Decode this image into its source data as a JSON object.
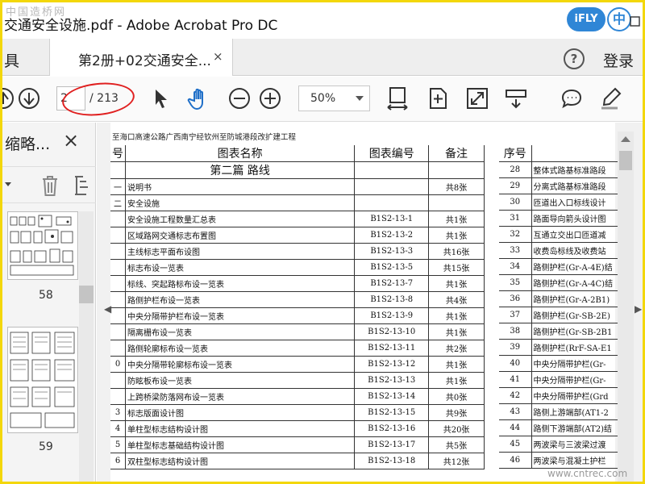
{
  "app": {
    "window_title": "交通安全设施.pdf - Adobe Acrobat Pro DC",
    "watermark": "中国造桥网",
    "ifly_label": "iFLY",
    "zh_label": "中",
    "footer_watermark": "www.cntrec.com"
  },
  "tabs": {
    "tools": "具",
    "document": "第2册+02交通安全...",
    "close": "×",
    "help": "?",
    "login": "登录"
  },
  "toolbar": {
    "page_current": "2",
    "page_total": "/ 213",
    "zoom": "50%"
  },
  "sidepanel": {
    "title": "缩略...",
    "close": "×",
    "thumb_labels": [
      "58",
      "59"
    ]
  },
  "document": {
    "title_line": "至海口高速公路广西南宁经钦州至防城港段改扩建工程",
    "left_headers": [
      "号",
      "图表名称",
      "图表编号",
      "备注"
    ],
    "right_headers": [
      "序号",
      ""
    ],
    "section_heading": "第二篇  路线",
    "left_rows": [
      {
        "no": "一",
        "name": "说明书",
        "code": "",
        "note": "共8张"
      },
      {
        "no": "二",
        "name": "安全设施",
        "code": "",
        "note": ""
      },
      {
        "no": "",
        "name": "安全设施工程数量汇总表",
        "code": "B1S2-13-1",
        "note": "共1张"
      },
      {
        "no": "",
        "name": "区域路网交通标志布置图",
        "code": "B1S2-13-2",
        "note": "共1张"
      },
      {
        "no": "",
        "name": "主线标志平面布设图",
        "code": "B1S2-13-3",
        "note": "共16张"
      },
      {
        "no": "",
        "name": "标志布设一览表",
        "code": "B1S2-13-5",
        "note": "共15张"
      },
      {
        "no": "",
        "name": "标线、突起路标布设一览表",
        "code": "B1S2-13-7",
        "note": "共1张"
      },
      {
        "no": "",
        "name": "路侧护栏布设一览表",
        "code": "B1S2-13-8",
        "note": "共4张"
      },
      {
        "no": "",
        "name": "中央分隔带护栏布设一览表",
        "code": "B1S2-13-9",
        "note": "共1张"
      },
      {
        "no": "",
        "name": "隔离栅布设一览表",
        "code": "B1S2-13-10",
        "note": "共1张"
      },
      {
        "no": "",
        "name": "路侧轮廓标布设一览表",
        "code": "B1S2-13-11",
        "note": "共2张"
      },
      {
        "no": "0",
        "name": "中央分隔带轮廓标布设一览表",
        "code": "B1S2-13-12",
        "note": "共1张"
      },
      {
        "no": "",
        "name": "防眩板布设一览表",
        "code": "B1S2-13-13",
        "note": "共1张"
      },
      {
        "no": "",
        "name": "上跨桥梁防落网布设一览表",
        "code": "B1S2-13-14",
        "note": "共0张"
      },
      {
        "no": "3",
        "name": "标志版面设计图",
        "code": "B1S2-13-15",
        "note": "共9张"
      },
      {
        "no": "4",
        "name": "单柱型标志结构设计图",
        "code": "B1S2-13-16",
        "note": "共20张"
      },
      {
        "no": "5",
        "name": "单柱型标志基础结构设计图",
        "code": "B1S2-13-17",
        "note": "共5张"
      },
      {
        "no": "6",
        "name": "双柱型标志结构设计图",
        "code": "B1S2-13-18",
        "note": "共12张"
      }
    ],
    "right_rows": [
      {
        "no": "28",
        "name": "整体式路基标准路段"
      },
      {
        "no": "29",
        "name": "分离式路基标准路段"
      },
      {
        "no": "30",
        "name": "匝道出入口标线设计"
      },
      {
        "no": "31",
        "name": "路面导向箭头设计图"
      },
      {
        "no": "32",
        "name": "互通立交出口匝道减"
      },
      {
        "no": "33",
        "name": "收费岛标线及收费站"
      },
      {
        "no": "34",
        "name": "路侧护栏(Gr-A-4E)结"
      },
      {
        "no": "35",
        "name": "路侧护栏(Gr-A-4C)结"
      },
      {
        "no": "36",
        "name": "路侧护栏(Gr-A-2B1)"
      },
      {
        "no": "37",
        "name": "路侧护栏(Gr-SB-2E)"
      },
      {
        "no": "38",
        "name": "路侧护栏(Gr-SB-2B1"
      },
      {
        "no": "39",
        "name": "路侧护栏(RrF-SA-E1"
      },
      {
        "no": "40",
        "name": "中央分隔带护栏(Gr-"
      },
      {
        "no": "41",
        "name": "中央分隔带护栏(Gr-"
      },
      {
        "no": "42",
        "name": "中央分隔带护栏(Grd"
      },
      {
        "no": "43",
        "name": "路侧上游端部(AT1-2"
      },
      {
        "no": "44",
        "name": "路侧下游端部(AT2)结"
      },
      {
        "no": "45",
        "name": "两波梁与三波梁过渡"
      },
      {
        "no": "46",
        "name": "两波梁与混凝土护栏"
      }
    ]
  }
}
